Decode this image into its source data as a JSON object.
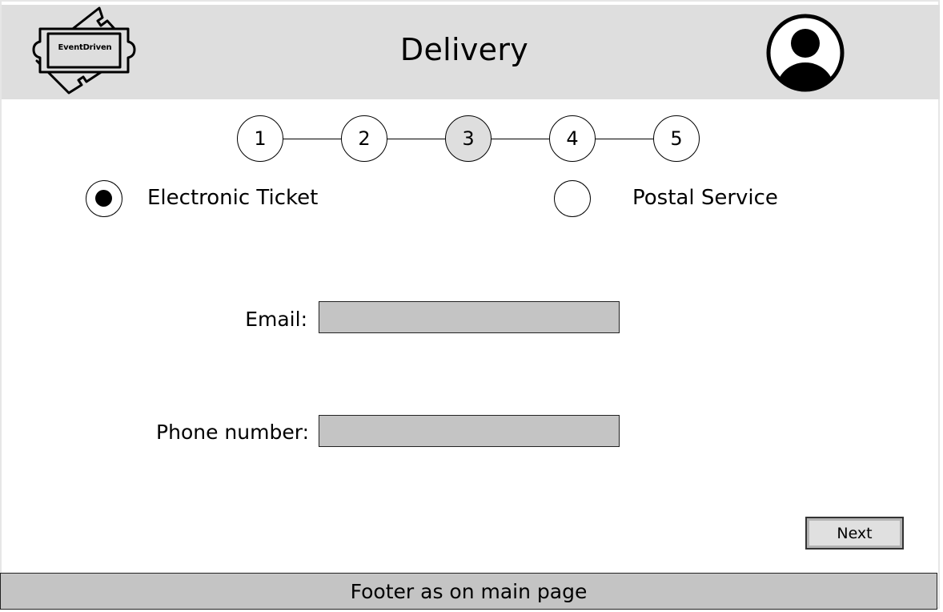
{
  "header": {
    "logo_text": "EventDriven",
    "title": "Delivery",
    "avatar_icon": "user-avatar-icon"
  },
  "stepper": {
    "steps": [
      "1",
      "2",
      "3",
      "4",
      "5"
    ],
    "active_step": "3"
  },
  "delivery_options": {
    "electronic": {
      "label": "Electronic Ticket",
      "selected": true
    },
    "postal": {
      "label": "Postal Service",
      "selected": false
    }
  },
  "form": {
    "email_label": "Email:",
    "email_value": "",
    "phone_label": "Phone number:",
    "phone_value": ""
  },
  "actions": {
    "next_label": "Next"
  },
  "footer": {
    "text": "Footer as on main page"
  },
  "colors": {
    "header_bg": "#dedede",
    "input_bg": "#c4c4c4",
    "footer_bg": "#c4c4c4"
  }
}
